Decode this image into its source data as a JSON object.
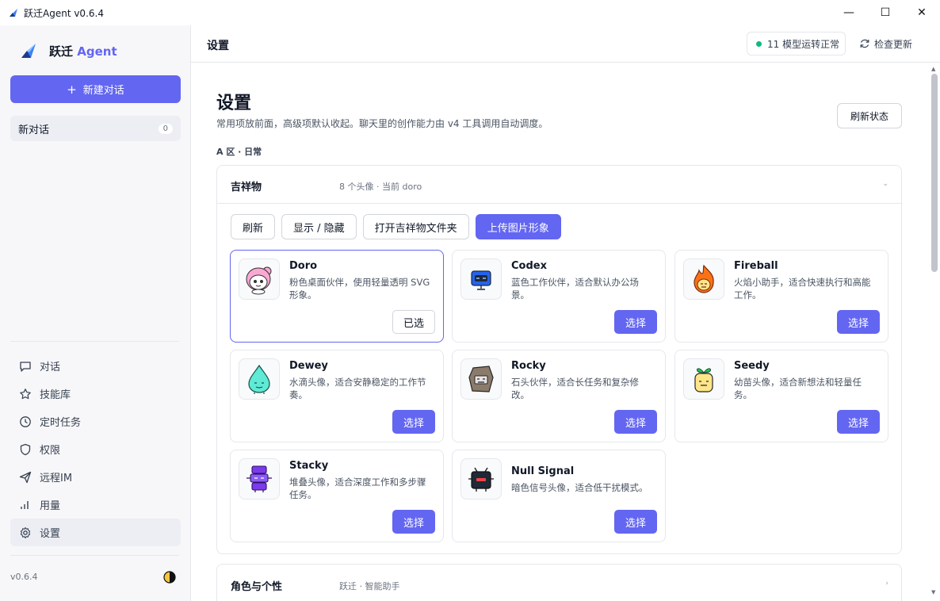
{
  "window": {
    "title": "跃迁Agent v0.6.4",
    "controls": {
      "minimize": "—",
      "maximize": "☐",
      "close": "✕"
    }
  },
  "sidebar": {
    "brand_name": "跃迁",
    "brand_accent": "Agent",
    "new_chat_label": "新建对话",
    "conversations": [
      {
        "label": "新对话",
        "count": "0"
      }
    ],
    "nav": [
      {
        "label": "对话",
        "icon": "chat-icon"
      },
      {
        "label": "技能库",
        "icon": "star-icon"
      },
      {
        "label": "定时任务",
        "icon": "clock-icon"
      },
      {
        "label": "权限",
        "icon": "shield-icon"
      },
      {
        "label": "远程IM",
        "icon": "send-icon"
      },
      {
        "label": "用量",
        "icon": "bar-chart-icon"
      },
      {
        "label": "设置",
        "icon": "gear-icon",
        "active": true
      }
    ],
    "version": "v0.6.4"
  },
  "header": {
    "title": "设置",
    "status": "11 模型运转正常",
    "update_label": "检查更新"
  },
  "main": {
    "title": "设置",
    "subtitle": "常用项放前面，高级项默认收起。聊天里的创作能力由 v4 工具调用自动调度。",
    "refresh_status": "刷新状态",
    "section_a": "A 区 · 日常",
    "mascot_panel": {
      "title": "吉祥物",
      "meta": "8 个头像 · 当前 doro",
      "chevron": "⌄",
      "toolbar": [
        "刷新",
        "显示 / 隐藏",
        "打开吉祥物文件夹",
        "上传图片形象"
      ],
      "cards": [
        {
          "name": "Doro",
          "desc": "粉色桌面伙伴，使用轻量透明 SVG 形象。",
          "button": "已选"
        },
        {
          "name": "Codex",
          "desc": "蓝色工作伙伴，适合默认办公场景。",
          "button": "选择"
        },
        {
          "name": "Fireball",
          "desc": "火焰小助手，适合快速执行和高能工作。",
          "button": "选择"
        },
        {
          "name": "Dewey",
          "desc": "水滴头像，适合安静稳定的工作节奏。",
          "button": "选择"
        },
        {
          "name": "Rocky",
          "desc": "石头伙伴，适合长任务和复杂修改。",
          "button": "选择"
        },
        {
          "name": "Seedy",
          "desc": "幼苗头像，适合新想法和轻量任务。",
          "button": "选择"
        },
        {
          "name": "Stacky",
          "desc": "堆叠头像，适合深度工作和多步骤任务。",
          "button": "选择"
        },
        {
          "name": "Null Signal",
          "desc": "暗色信号头像，适合低干扰模式。",
          "button": "选择"
        }
      ]
    },
    "role_panel": {
      "title": "角色与个性",
      "meta": "跃迁 · 智能助手",
      "chevron": "›"
    }
  },
  "colors": {
    "accent": "#6366f1",
    "status_ok": "#10b981"
  }
}
